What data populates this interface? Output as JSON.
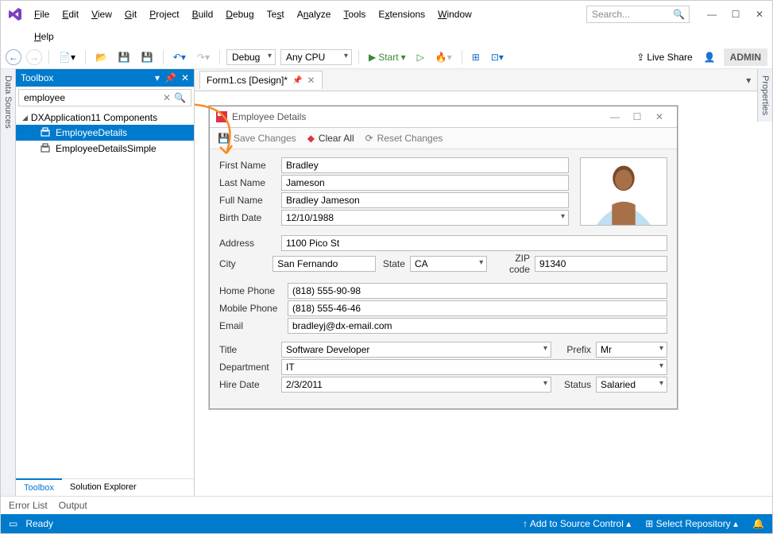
{
  "menu": [
    "File",
    "Edit",
    "View",
    "Git",
    "Project",
    "Build",
    "Debug",
    "Test",
    "Analyze",
    "Tools",
    "Extensions",
    "Window",
    "Help"
  ],
  "search_placeholder": "Search...",
  "admin_label": "ADMIN",
  "toolbar": {
    "config": "Debug",
    "platform": "Any CPU",
    "start": "Start",
    "live_share": "Live Share"
  },
  "side_left": "Data Sources",
  "side_right": "Properties",
  "toolbox": {
    "title": "Toolbox",
    "search_value": "employee",
    "group": "DXApplication11 Components",
    "items": [
      "EmployeeDetails",
      "EmployeeDetailsSimple"
    ],
    "tabs": [
      "Toolbox",
      "Solution Explorer"
    ]
  },
  "doc_tab": "Form1.cs [Design]*",
  "form": {
    "title": "Employee Details",
    "toolbar": {
      "save": "Save Changes",
      "clear": "Clear All",
      "reset": "Reset Changes"
    },
    "labels": {
      "first_name": "First Name",
      "last_name": "Last Name",
      "full_name": "Full Name",
      "birth_date": "Birth Date",
      "address": "Address",
      "city": "City",
      "state": "State",
      "zip": "ZIP code",
      "home_phone": "Home Phone",
      "mobile_phone": "Mobile Phone",
      "email": "Email",
      "title": "Title",
      "department": "Department",
      "hire_date": "Hire Date",
      "prefix": "Prefix",
      "status": "Status"
    },
    "values": {
      "first_name": "Bradley",
      "last_name": "Jameson",
      "full_name": "Bradley Jameson",
      "birth_date": "12/10/1988",
      "address": "1100 Pico St",
      "city": "San Fernando",
      "state": "CA",
      "zip": "91340",
      "home_phone": "(818) 555-90-98",
      "mobile_phone": "(818) 555-46-46",
      "email": "bradleyj@dx-email.com",
      "title": "Software Developer",
      "department": "IT",
      "hire_date": "2/3/2011",
      "prefix": "Mr",
      "status": "Salaried"
    }
  },
  "bottom_tabs": [
    "Error List",
    "Output"
  ],
  "status": {
    "ready": "Ready",
    "source_control": "Add to Source Control",
    "repo": "Select Repository"
  }
}
